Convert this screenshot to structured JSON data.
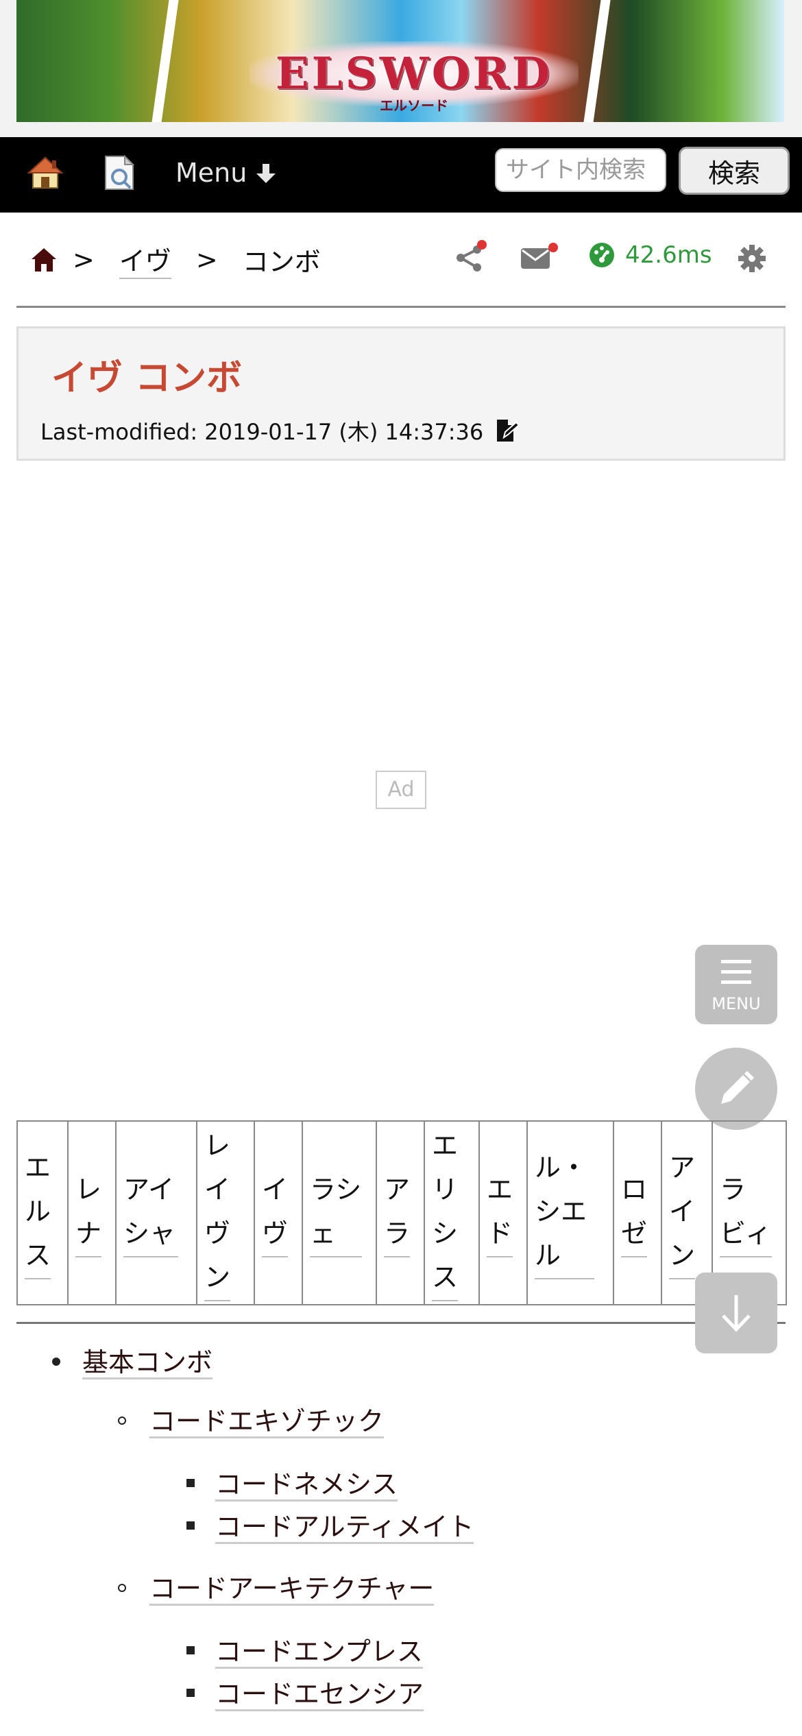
{
  "banner": {
    "logo": "ELSWORD",
    "logo_sub": "エルソード"
  },
  "nav": {
    "menu_label": "Menu",
    "search_placeholder": "サイト内検索",
    "search_button": "検索"
  },
  "breadcrumb": {
    "separator": ">",
    "parent": "イヴ",
    "current": "コンボ"
  },
  "tools": {
    "render_time": "42.6ms"
  },
  "page": {
    "title": "イヴ コンボ",
    "last_modified": "Last-modified: 2019-01-17 (木) 14:37:36"
  },
  "ad": {
    "label": "Ad"
  },
  "fab": {
    "menu_label": "MENU"
  },
  "characters": [
    "エルス",
    "レナ",
    "アイシャ",
    "レイヴン",
    "イヴ",
    "ラシェ",
    "アラ",
    "エリシス",
    "エド",
    "ル・シエル",
    "ロゼ",
    "アイン",
    "ラビィ"
  ],
  "combos": {
    "root": "基本コンボ",
    "groups": [
      {
        "label": "コードエキゾチック",
        "items": [
          "コードネメシス",
          "コードアルティメイト"
        ]
      },
      {
        "label": "コードアーキテクチャー",
        "items": [
          "コードエンプレス",
          "コードエセンシア"
        ]
      }
    ]
  },
  "colors": {
    "title": "#c64a33",
    "speed": "#2e9a3c",
    "notify_dot": "#e03333"
  }
}
